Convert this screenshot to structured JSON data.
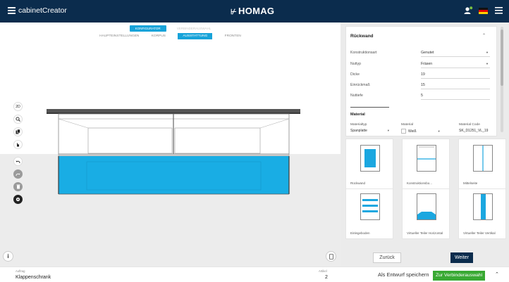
{
  "app": {
    "title": "cabinetCreator",
    "logo": "HOMAG"
  },
  "colors": {
    "header": "#0b2c4d",
    "accent": "#17a3d9",
    "green": "#39a933"
  },
  "stepper": {
    "main": [
      "KONFIGURATOR",
      "VERBINDERAUSWAHL"
    ],
    "active_main": 0,
    "sub": [
      "HAUPTEINSTELLUNGEN",
      "KORPUS",
      "AUSSTATTUNG",
      "FRONTEN"
    ],
    "active_sub": 2
  },
  "tools": {
    "view_2d": "2D"
  },
  "panel": {
    "title": "Rückwand",
    "fields": [
      {
        "label": "Konstruktionsart",
        "value": "Genutet",
        "dropdown": true
      },
      {
        "label": "Nuttyp",
        "value": "Fräsen",
        "dropdown": true
      },
      {
        "label": "Dicke",
        "value": "19",
        "dropdown": false
      },
      {
        "label": "Einrückmaß",
        "value": "15",
        "dropdown": false
      },
      {
        "label": "Nuttiefe",
        "value": "5",
        "dropdown": false
      }
    ],
    "material": {
      "title": "Material",
      "headers": [
        "Materialtyp",
        "Material",
        "Material Code"
      ],
      "values": [
        "Spanplatte",
        "Weiß",
        "SK_D1251_VL_19"
      ]
    }
  },
  "tiles": [
    {
      "label": "Rückwand",
      "icon": "back-panel-icon"
    },
    {
      "label": "Konstruktionsbo...",
      "icon": "construction-floor-icon"
    },
    {
      "label": "Mittelseite",
      "icon": "middle-side-icon"
    },
    {
      "label": "Einlegeboden",
      "icon": "shelf-icon"
    },
    {
      "label": "Virtueller Teiler Horizontal",
      "icon": "horizontal-divider-icon"
    },
    {
      "label": "Virtueller Teiler Vertikal",
      "icon": "vertical-divider-icon"
    }
  ],
  "buttons": {
    "back": "Zurück",
    "next": "Weiter",
    "save_draft": "Als Entwurf speichern",
    "connectors": "Zur Verbinderauswahl"
  },
  "footer": {
    "order_label": "Auftrag",
    "order_value": "Klappenschrank",
    "article_label": "Artikel",
    "article_value": "2"
  }
}
